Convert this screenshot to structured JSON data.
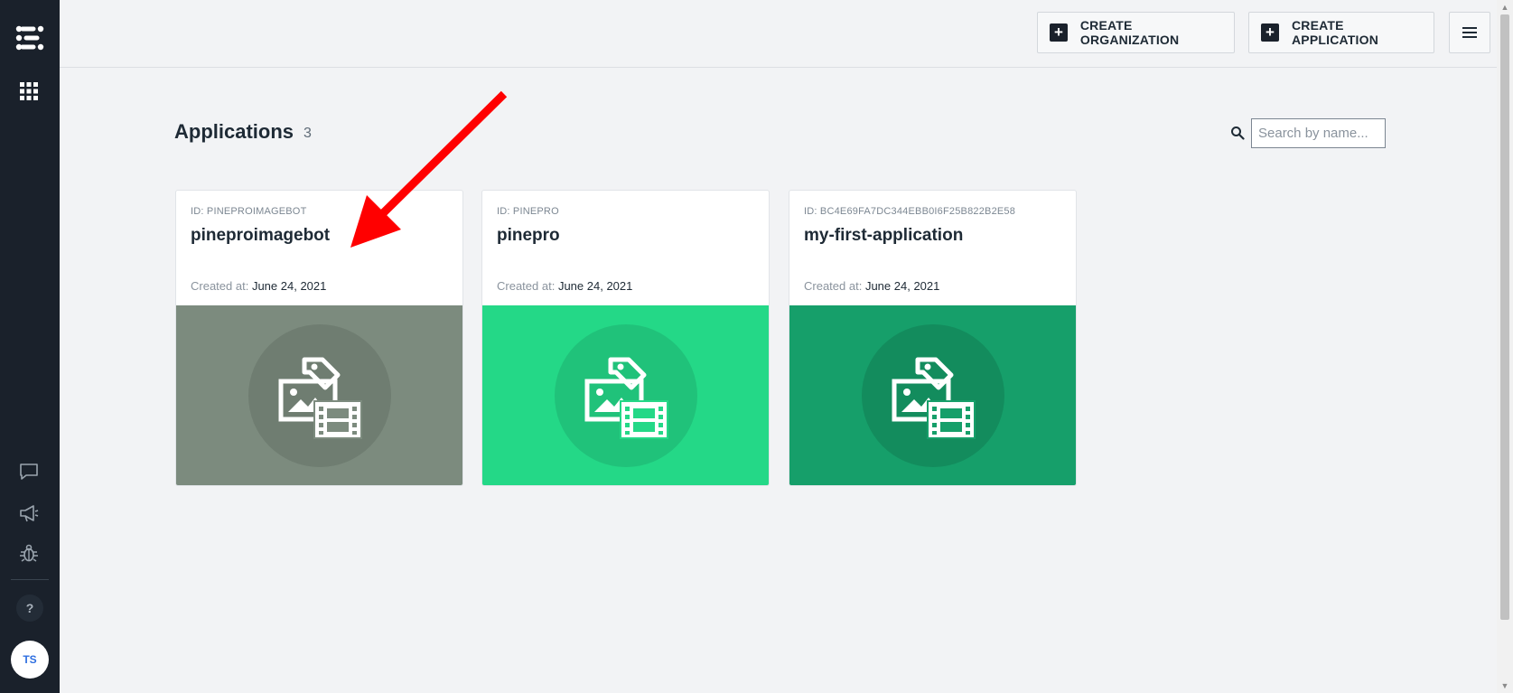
{
  "sidebar": {
    "logo_icon": "clarifai-logo-icon",
    "apps_icon": "grid-apps-icon",
    "icons": [
      "chat-icon",
      "megaphone-icon",
      "bug-icon"
    ],
    "help_label": "?",
    "avatar_initials": "TS"
  },
  "topbar": {
    "create_org_label": "CREATE ORGANIZATION",
    "create_app_label": "CREATE APPLICATION",
    "menu_icon": "hamburger-menu-icon"
  },
  "page": {
    "title": "Applications",
    "count": "3"
  },
  "search": {
    "placeholder": "Search by name...",
    "value": ""
  },
  "cards": [
    {
      "id_label": "ID: PINEPROIMAGEBOT",
      "name": "pineproimagebot",
      "created_key": "Created at:",
      "created_value": "June 24, 2021",
      "banner_color": "#7c8b7e",
      "circle_color": "#6f7d71"
    },
    {
      "id_label": "ID: PINEPRO",
      "name": "pinepro",
      "created_key": "Created at:",
      "created_value": "June 24, 2021",
      "banner_color": "#24d887",
      "circle_color": "#20c27a"
    },
    {
      "id_label": "ID: BC4E69FA7DC344EBB0I6F25B822B2E58",
      "name": "my-first-application",
      "created_key": "Created at:",
      "created_value": "June 24, 2021",
      "banner_color": "#169f6a",
      "circle_color": "#138c5d"
    }
  ],
  "annotation": {
    "arrow_color": "#ff0000"
  }
}
